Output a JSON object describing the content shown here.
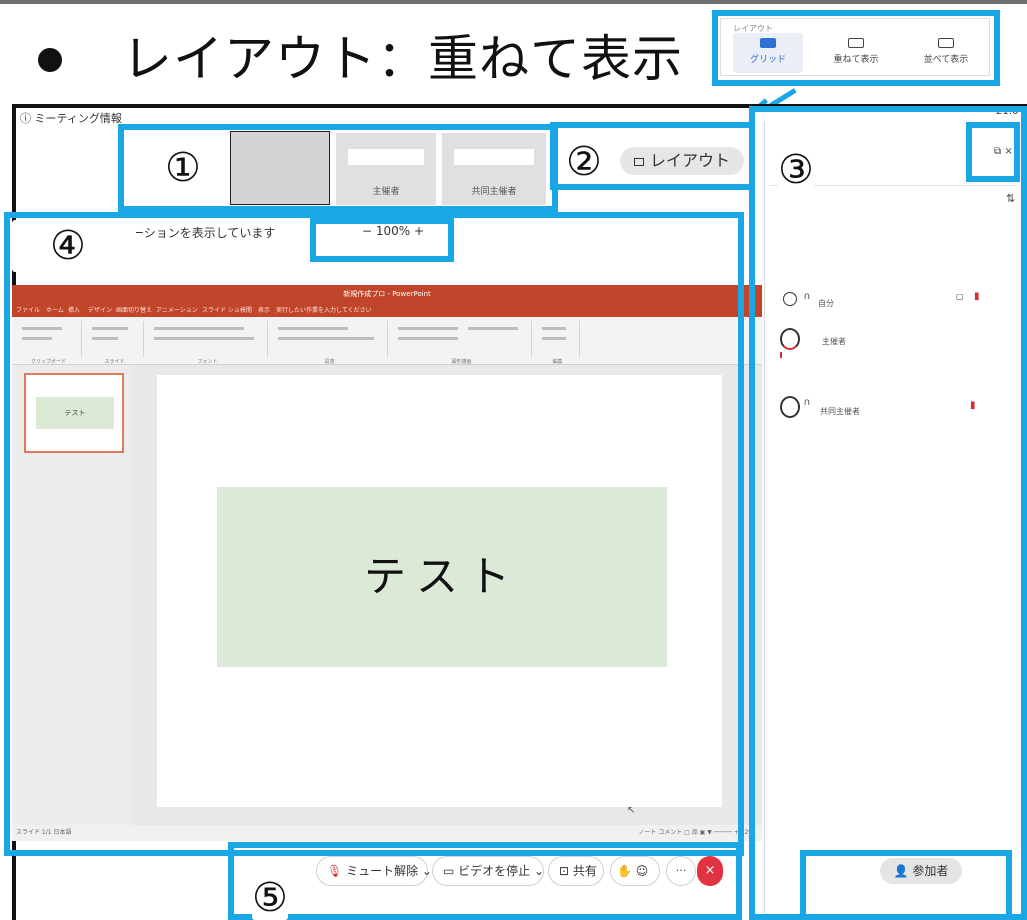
{
  "slide_heading": "レイアウト：重ねて表示",
  "layout_popup": {
    "title": "レイアウト",
    "options": [
      "グリッド",
      "重ねて表示",
      "並べて表示"
    ],
    "selected": "グリッド"
  },
  "window": {
    "meeting_info": "ⓘ ミーティング情報",
    "clock": "21:0",
    "thumbnails": [
      {
        "name": ""
      },
      {
        "name": "主催者"
      },
      {
        "name": "共同主催者"
      }
    ],
    "layout_button": "レイアウト",
    "sharing_text": "ーションを表示しています",
    "zoom": {
      "minus": "−",
      "value": "100%",
      "plus": "+"
    }
  },
  "powerpoint": {
    "title": "新規作成プロ - PowerPoint",
    "tabs": [
      "ファイル",
      "ホーム",
      "挿入",
      "デザイン",
      "画面切り替え",
      "アニメーション",
      "スライド ショー",
      "校閲",
      "表示",
      "実行したい作業を入力してください"
    ],
    "ribbon_groups": [
      "クリップボード",
      "スライド",
      "フォント",
      "段落",
      "図形描画",
      "編集"
    ],
    "slide_thumb_text": "テスト",
    "slide_text": "テスト",
    "status_left": "スライド 1/1  日本語",
    "status_right": "ノート  コメント  □  品  ▣  ▼  ─────  +  72%"
  },
  "participants": {
    "popout": "⧉ ×",
    "sort_icon": "⇅",
    "list": [
      {
        "name": "自分",
        "role": "self",
        "muted": true
      },
      {
        "name": "主催者",
        "role": "host",
        "muted": false
      },
      {
        "name": "共同主催者",
        "role": "co-host",
        "muted": true
      }
    ],
    "button": "参加者"
  },
  "toolbar": {
    "unmute": "ミュート解除 ⌄",
    "stop_video": "ビデオを停止 ⌄",
    "share": "共有",
    "raise_hand": "✋",
    "reaction": "☺",
    "more": "···",
    "end": "×"
  },
  "callouts": [
    "①",
    "②",
    "③",
    "④",
    "⑤"
  ],
  "colors": {
    "highlight": "#1ba7e6",
    "ppt_red": "#c0452a",
    "slide_box": "#dce9d6",
    "end_call": "#e0333f"
  }
}
